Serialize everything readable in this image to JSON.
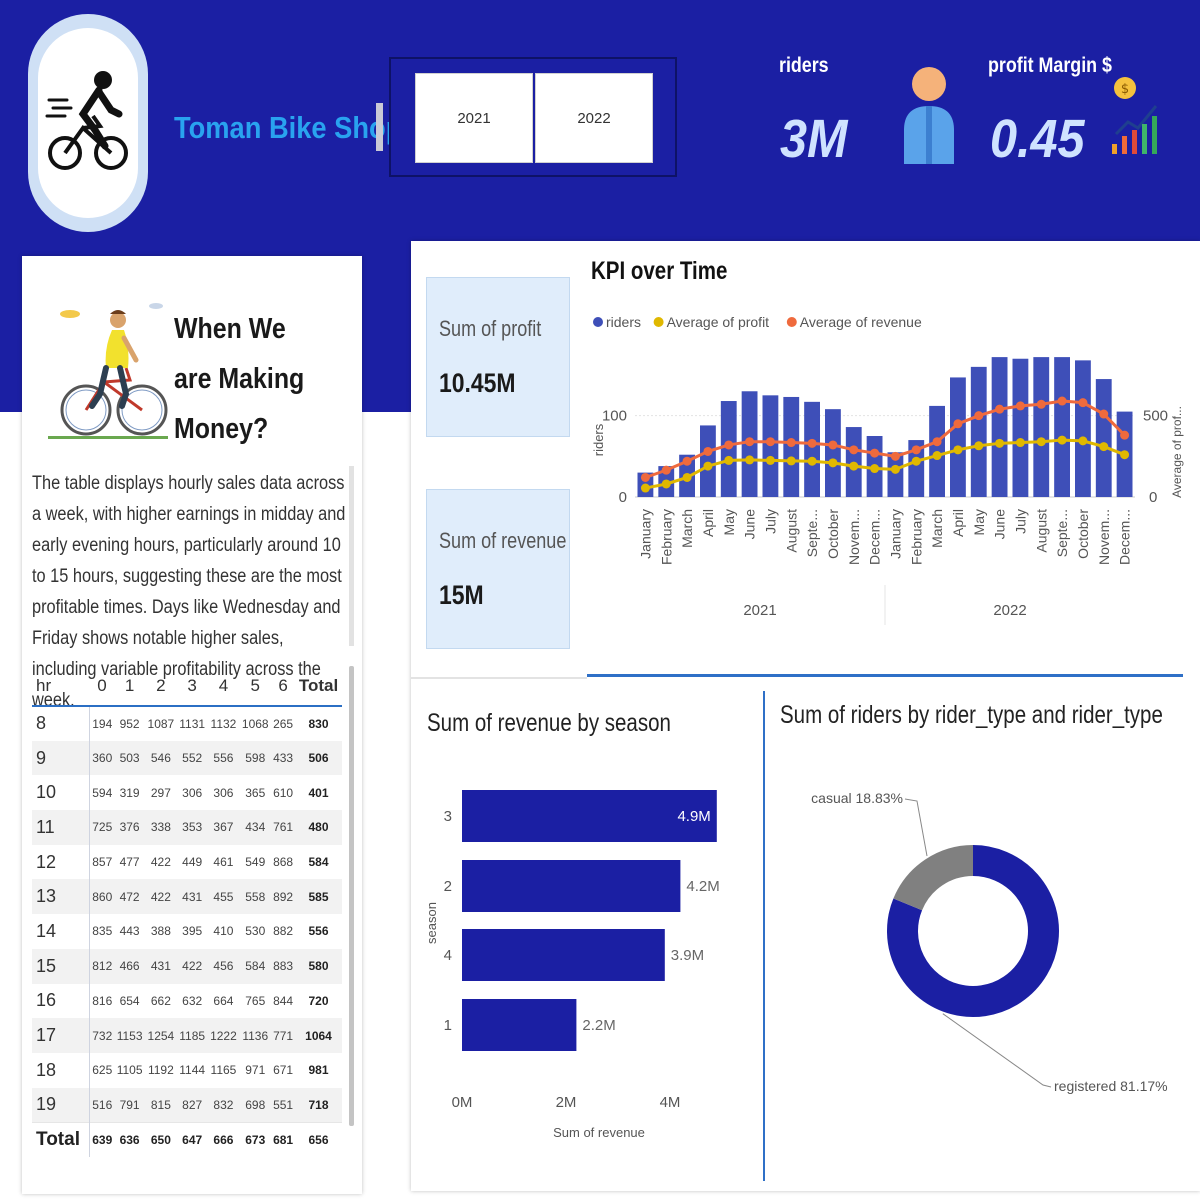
{
  "header": {
    "shop_name": "Toman Bike Shop",
    "years": [
      "2021",
      "2022"
    ],
    "kpis": [
      {
        "label": "riders",
        "value": "3M"
      },
      {
        "label": "profit Margin $",
        "value": "0.45"
      }
    ]
  },
  "making_money": {
    "heading": "When We are Making Money?",
    "description": "The table displays hourly sales data across a week, with higher earnings in midday and early evening hours, particularly around 10 to 15 hours, suggesting these are the most profitable times. Days  like Wednesday and Friday shows notable higher sales, including variable profitability across the week.",
    "columns": [
      "hr",
      "0",
      "1",
      "2",
      "3",
      "4",
      "5",
      "6",
      "Total"
    ],
    "rows": [
      {
        "hr": "8",
        "cells": [
          "194",
          "952",
          "1087",
          "1131",
          "1132",
          "1068",
          "265"
        ],
        "total": "830"
      },
      {
        "hr": "9",
        "cells": [
          "360",
          "503",
          "546",
          "552",
          "556",
          "598",
          "433"
        ],
        "total": "506"
      },
      {
        "hr": "10",
        "cells": [
          "594",
          "319",
          "297",
          "306",
          "306",
          "365",
          "610"
        ],
        "total": "401"
      },
      {
        "hr": "11",
        "cells": [
          "725",
          "376",
          "338",
          "353",
          "367",
          "434",
          "761"
        ],
        "total": "480"
      },
      {
        "hr": "12",
        "cells": [
          "857",
          "477",
          "422",
          "449",
          "461",
          "549",
          "868"
        ],
        "total": "584"
      },
      {
        "hr": "13",
        "cells": [
          "860",
          "472",
          "422",
          "431",
          "455",
          "558",
          "892"
        ],
        "total": "585"
      },
      {
        "hr": "14",
        "cells": [
          "835",
          "443",
          "388",
          "395",
          "410",
          "530",
          "882"
        ],
        "total": "556"
      },
      {
        "hr": "15",
        "cells": [
          "812",
          "466",
          "431",
          "422",
          "456",
          "584",
          "883"
        ],
        "total": "580"
      },
      {
        "hr": "16",
        "cells": [
          "816",
          "654",
          "662",
          "632",
          "664",
          "765",
          "844"
        ],
        "total": "720"
      },
      {
        "hr": "17",
        "cells": [
          "732",
          "1153",
          "1254",
          "1185",
          "1222",
          "1136",
          "771"
        ],
        "total": "1064"
      },
      {
        "hr": "18",
        "cells": [
          "625",
          "1105",
          "1192",
          "1144",
          "1165",
          "971",
          "671"
        ],
        "total": "981"
      },
      {
        "hr": "19",
        "cells": [
          "516",
          "791",
          "815",
          "827",
          "832",
          "698",
          "551"
        ],
        "total": "718"
      }
    ],
    "total_row": {
      "hr": "Total",
      "cells": [
        "639",
        "636",
        "650",
        "647",
        "666",
        "673",
        "681"
      ],
      "total": "656"
    }
  },
  "cards": [
    {
      "label": "Sum of profit",
      "value": "10.45M"
    },
    {
      "label": "Sum of revenue",
      "value": "15M"
    }
  ],
  "charts": {
    "kpi_title": "KPI over Time",
    "season_title": "Sum of revenue by season",
    "donut_title": "Sum of riders by rider_type and rider_type"
  },
  "chart_data": [
    {
      "type": "bar",
      "title": "KPI over Time",
      "legend": [
        "riders",
        "Average of profit",
        "Average of revenue"
      ],
      "legend_position": "top-left",
      "ylabel": "riders",
      "y2label": "Average of prof...",
      "y_ticks": [
        "0",
        "100"
      ],
      "y2_ticks": [
        "0",
        "500"
      ],
      "ylim": [
        0,
        150
      ],
      "y2lim": [
        0,
        750
      ],
      "months": [
        "January",
        "February",
        "March",
        "April",
        "May",
        "June",
        "July",
        "August",
        "Septe...",
        "October",
        "Novem...",
        "Decem...",
        "January",
        "February",
        "March",
        "April",
        "May",
        "June",
        "July",
        "August",
        "Septe...",
        "October",
        "Novem...",
        "Decem..."
      ],
      "years": [
        "2021",
        "2022"
      ],
      "series": [
        {
          "name": "riders",
          "kind": "bar",
          "color": "#3e4fb8",
          "values": [
            30,
            38,
            52,
            88,
            118,
            130,
            125,
            123,
            117,
            108,
            86,
            75,
            55,
            70,
            112,
            147,
            160,
            172,
            170,
            172,
            172,
            168,
            145,
            105
          ]
        },
        {
          "name": "Average of profit",
          "kind": "line",
          "axis": "y2",
          "color": "#e0b800",
          "values": [
            55,
            80,
            120,
            190,
            225,
            228,
            225,
            222,
            220,
            210,
            190,
            175,
            170,
            220,
            255,
            290,
            315,
            330,
            335,
            340,
            350,
            345,
            310,
            260
          ]
        },
        {
          "name": "Average of revenue",
          "kind": "line",
          "axis": "y2",
          "color": "#ef6a3d",
          "values": [
            120,
            165,
            220,
            280,
            320,
            340,
            340,
            335,
            330,
            320,
            290,
            270,
            250,
            290,
            340,
            450,
            500,
            540,
            560,
            570,
            590,
            580,
            510,
            380
          ]
        }
      ]
    },
    {
      "type": "bar",
      "orientation": "horizontal",
      "title": "Sum of revenue by season",
      "xlabel": "Sum of revenue",
      "ylabel": "season",
      "categories": [
        "3",
        "2",
        "4",
        "1"
      ],
      "values": [
        4.9,
        4.2,
        3.9,
        2.2
      ],
      "value_labels": [
        "4.9M",
        "4.2M",
        "3.9M",
        "2.2M"
      ],
      "x_ticks": [
        "0M",
        "2M",
        "4M"
      ],
      "xlim": [
        0,
        5
      ],
      "color": "#1b1fa3"
    },
    {
      "type": "pie",
      "variant": "donut",
      "title": "Sum of riders by rider_type and rider_type",
      "categories": [
        "registered",
        "casual"
      ],
      "values": [
        81.17,
        18.83
      ],
      "labels": [
        "registered 81.17%",
        "casual 18.83%"
      ],
      "colors": [
        "#1b1fa3",
        "#808080"
      ]
    }
  ]
}
